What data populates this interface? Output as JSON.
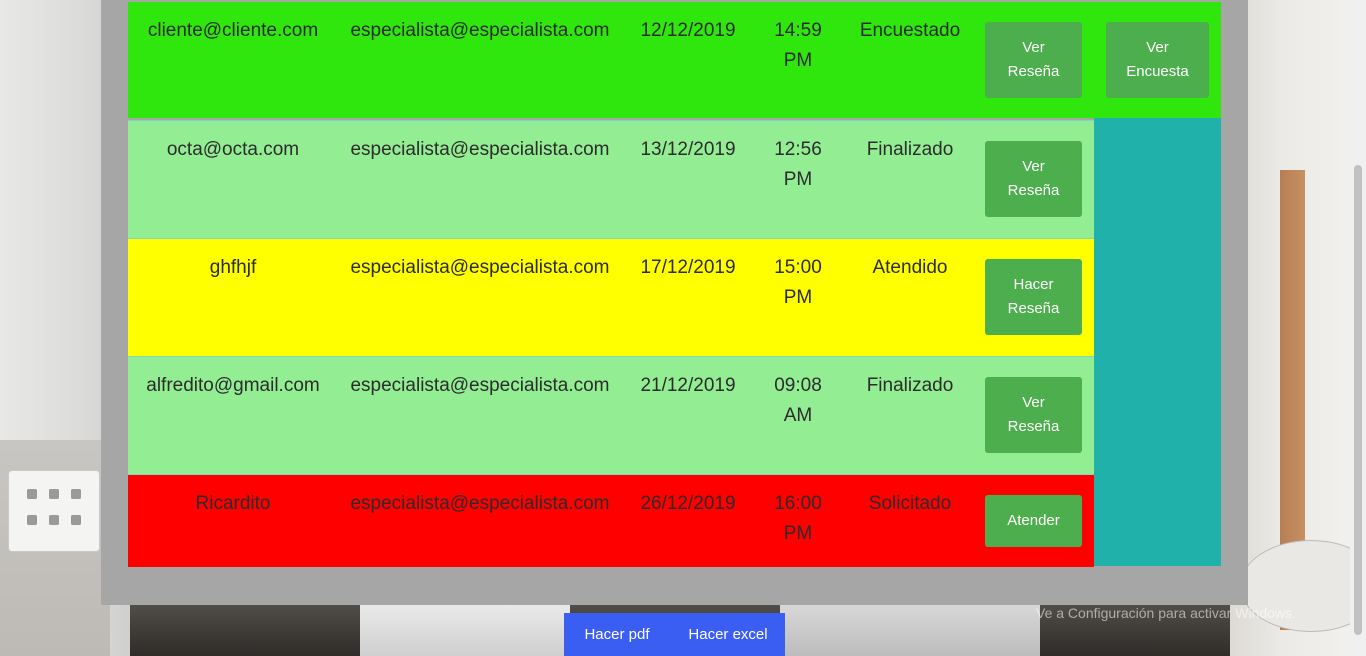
{
  "appointments": [
    {
      "client": "cliente@cliente.com",
      "specialist": "especialista@especialista.com",
      "date": "12/12/2019",
      "time_a": "14:59",
      "time_b": "PM",
      "status": "Encuestado",
      "color": "#2fe70c",
      "actions": [
        {
          "line1": "Ver",
          "line2": "Reseña"
        },
        {
          "line1": "Ver",
          "line2": "Encuesta"
        }
      ]
    },
    {
      "client": "octa@octa.com",
      "specialist": "especialista@especialista.com",
      "date": "13/12/2019",
      "time_a": "12:56",
      "time_b": "PM",
      "status": "Finalizado",
      "color": "#93ee93",
      "actions": [
        {
          "line1": "Ver",
          "line2": "Reseña"
        }
      ]
    },
    {
      "client": "ghfhjf",
      "specialist": "especialista@especialista.com",
      "date": "17/12/2019",
      "time_a": "15:00",
      "time_b": "PM",
      "status": "Atendido",
      "color": "#ffff00",
      "actions": [
        {
          "line1": "Hacer",
          "line2": "Reseña"
        }
      ]
    },
    {
      "client": "alfredito@gmail.com",
      "specialist": "especialista@especialista.com",
      "date": "21/12/2019",
      "time_a": "09:08",
      "time_b": "AM",
      "status": "Finalizado",
      "color": "#93ee93",
      "actions": [
        {
          "line1": "Ver",
          "line2": "Reseña"
        }
      ]
    },
    {
      "client": "Ricardito",
      "specialist": "especialista@especialista.com",
      "date": "26/12/2019",
      "time_a": "16:00",
      "time_b": "PM",
      "status": "Solicitado",
      "color": "#ff0000",
      "actions": [
        {
          "line1": "Atender"
        }
      ]
    }
  ],
  "footer": {
    "pdf_label": "Hacer pdf",
    "excel_label": "Hacer excel"
  },
  "watermark": "Ve a Configuración para activar Windows.",
  "colors": {
    "button": "#4cae4c",
    "teal": "#20b2aa",
    "footer": "#3b5ef2",
    "panel": "#a6a6a6"
  }
}
